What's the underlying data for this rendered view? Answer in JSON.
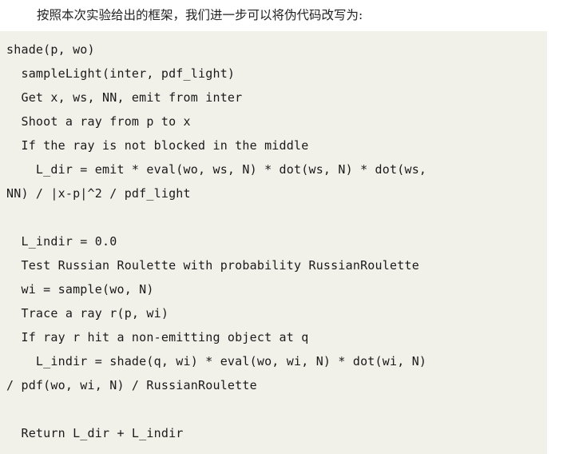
{
  "document": {
    "paragraph": "按照本次实验给出的框架，我们进一步可以将伪代码改写为:",
    "code_block": {
      "background_color": "#f1f1ea",
      "text_color": "#1a1a1a",
      "lines": [
        "shade(p, wo)",
        "  sampleLight(inter, pdf_light)",
        "  Get x, ws, NN, emit from inter",
        "  Shoot a ray from p to x",
        "  If the ray is not blocked in the middle",
        "    L_dir = emit * eval(wo, ws, N) * dot(ws, N) * dot(ws,",
        "NN) / |x-p|^2 / pdf_light",
        "",
        "  L_indir = 0.0",
        "  Test Russian Roulette with probability RussianRoulette",
        "  wi = sample(wo, N)",
        "  Trace a ray r(p, wi)",
        "  If ray r hit a non-emitting object at q",
        "    L_indir = shade(q, wi) * eval(wo, wi, N) * dot(wi, N)",
        "/ pdf(wo, wi, N) / RussianRoulette",
        "",
        "  Return L_dir + L_indir"
      ]
    }
  }
}
